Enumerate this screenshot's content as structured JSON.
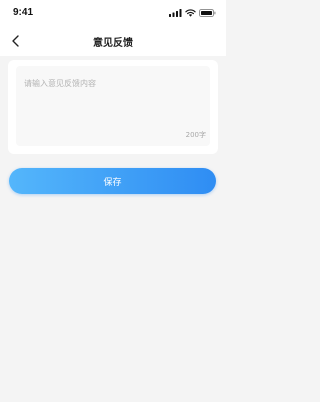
{
  "status_bar": {
    "time": "9:41",
    "icons": [
      "signal-icon",
      "wifi-icon",
      "battery-icon"
    ]
  },
  "nav": {
    "back_icon": "chevron-left-icon",
    "title": "意见反馈"
  },
  "feedback": {
    "value": "",
    "placeholder": "请输入意见反馈内容",
    "char_limit_label": "200字"
  },
  "actions": {
    "save_label": "保存"
  },
  "colors": {
    "page_background": "#f4f4f4",
    "button_gradient_start": "#54b6fb",
    "button_gradient_end": "#2f8df3",
    "placeholder_text": "#b3b3b3"
  }
}
